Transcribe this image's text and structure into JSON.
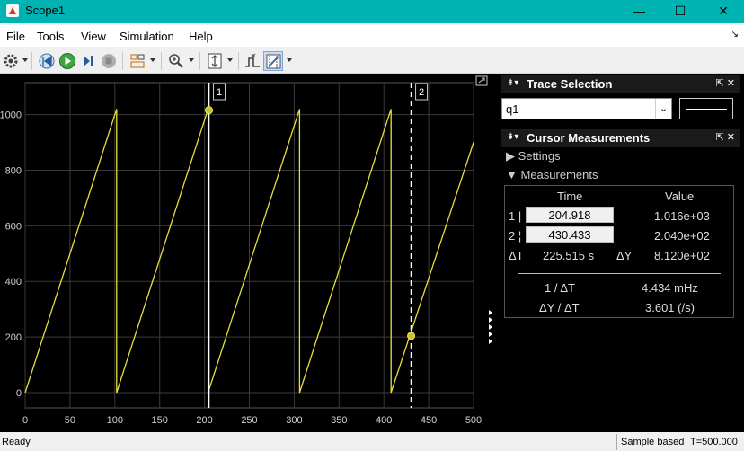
{
  "window": {
    "title": "Scope1",
    "minimize": "—",
    "maximize": "☐",
    "close": "✕"
  },
  "menubar": {
    "items": [
      "File",
      "Tools",
      "View",
      "Simulation",
      "Help"
    ],
    "undock": "↘"
  },
  "toolbar": {
    "icons": [
      "gear-icon",
      "step-back-icon",
      "run-icon",
      "step-forward-icon",
      "stop-icon",
      "layout-icon",
      "zoom-icon",
      "scale-axes-icon",
      "triggers-icon",
      "cursor-measurements-icon"
    ]
  },
  "plot": {
    "x_ticks": [
      "0",
      "50",
      "100",
      "150",
      "200",
      "250",
      "300",
      "350",
      "400",
      "450",
      "500"
    ],
    "y_ticks": [
      "0",
      "200",
      "400",
      "600",
      "800",
      "1000"
    ],
    "cursor1_label": "1",
    "cursor2_label": "2",
    "trace_color": "#e8df3a",
    "marker_fill": "#c9bf30"
  },
  "chart_data": {
    "type": "line",
    "xlim": [
      0,
      500
    ],
    "ylim": [
      -55,
      1115
    ],
    "grid": true,
    "series": [
      {
        "x": [
          0,
          102,
          102,
          204,
          204,
          306,
          306,
          408,
          408,
          500
        ],
        "y": [
          0,
          1020,
          0,
          1020,
          0,
          1020,
          0,
          1020,
          0,
          900
        ]
      }
    ],
    "cursors": [
      {
        "label": "1",
        "x": 204.918,
        "y": 1016,
        "style": "solid"
      },
      {
        "label": "2",
        "x": 430.433,
        "y": 204,
        "style": "dashed"
      }
    ]
  },
  "trace_selection": {
    "title": "Trace Selection",
    "value": "q1"
  },
  "cursor_measurements": {
    "title": "Cursor Measurements",
    "settings_label": "Settings",
    "measurements_label": "Measurements",
    "col_time": "Time",
    "col_value": "Value",
    "row1_label": "1 |",
    "row1_time": "204.918",
    "row1_value": "1.016e+03",
    "row2_label": "2 ¦",
    "row2_time": "430.433",
    "row2_value": "2.040e+02",
    "dt_label": "ΔT",
    "dt_value": "225.515 s",
    "dy_label": "ΔY",
    "dy_value": "8.120e+02",
    "inv_dt_label": "1 / ΔT",
    "inv_dt_value": "4.434 mHz",
    "dy_dt_label": "ΔY / ΔT",
    "dy_dt_value": "3.601 (/s)"
  },
  "statusbar": {
    "ready": "Ready",
    "mode": "Sample based",
    "time": "T=500.000"
  }
}
